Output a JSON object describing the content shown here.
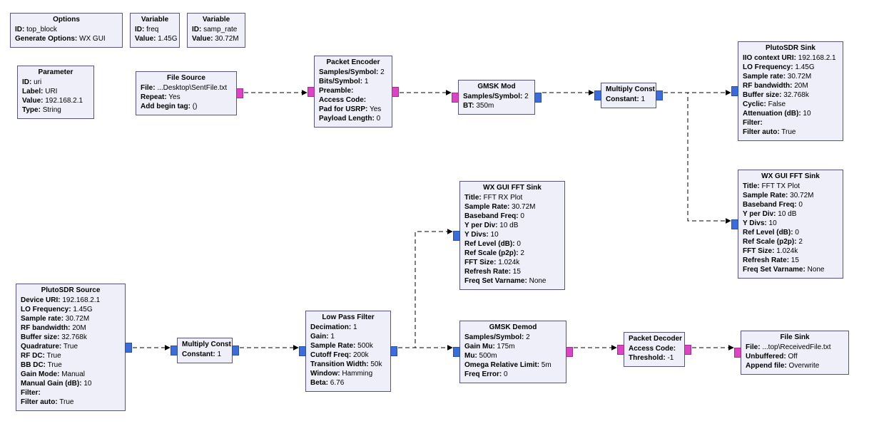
{
  "colors": {
    "block_bg": "#EFEFFA",
    "block_border": "#555577",
    "port_blue": "#3D6CD9",
    "port_magenta": "#D946C2",
    "arrow": "#000000"
  },
  "options": {
    "title": "Options",
    "rows": [
      {
        "k": "ID",
        "v": "top_block"
      },
      {
        "k": "Generate Options",
        "v": "WX GUI"
      }
    ]
  },
  "var_freq": {
    "title": "Variable",
    "rows": [
      {
        "k": "ID",
        "v": "freq"
      },
      {
        "k": "Value",
        "v": "1.45G"
      }
    ]
  },
  "var_samp": {
    "title": "Variable",
    "rows": [
      {
        "k": "ID",
        "v": "samp_rate"
      },
      {
        "k": "Value",
        "v": "30.72M"
      }
    ]
  },
  "parameter": {
    "title": "Parameter",
    "rows": [
      {
        "k": "ID",
        "v": "uri"
      },
      {
        "k": "Label",
        "v": "URI"
      },
      {
        "k": "Value",
        "v": "192.168.2.1"
      },
      {
        "k": "Type",
        "v": "String"
      }
    ]
  },
  "file_source": {
    "title": "File Source",
    "rows": [
      {
        "k": "File",
        "v": "...Desktop\\SentFile.txt"
      },
      {
        "k": "Repeat",
        "v": "Yes"
      },
      {
        "k": "Add begin tag",
        "v": "()"
      }
    ]
  },
  "packet_encoder": {
    "title": "Packet Encoder",
    "rows": [
      {
        "k": "Samples/Symbol",
        "v": "2"
      },
      {
        "k": "Bits/Symbol",
        "v": "1"
      },
      {
        "k": "Preamble",
        "v": ""
      },
      {
        "k": "Access Code",
        "v": ""
      },
      {
        "k": "Pad for USRP",
        "v": "Yes"
      },
      {
        "k": "Payload Length",
        "v": "0"
      }
    ]
  },
  "gmsk_mod": {
    "title": "GMSK Mod",
    "rows": [
      {
        "k": "Samples/Symbol",
        "v": "2"
      },
      {
        "k": "BT",
        "v": "350m"
      }
    ]
  },
  "mult_const_tx": {
    "title": "Multiply Const",
    "rows": [
      {
        "k": "Constant",
        "v": "1"
      }
    ]
  },
  "pluto_sink": {
    "title": "PlutoSDR Sink",
    "rows": [
      {
        "k": "IIO context URI",
        "v": "192.168.2.1"
      },
      {
        "k": "LO Frequency",
        "v": "1.45G"
      },
      {
        "k": "Sample rate",
        "v": "30.72M"
      },
      {
        "k": "RF bandwidth",
        "v": "20M"
      },
      {
        "k": "Buffer size",
        "v": "32.768k"
      },
      {
        "k": "Cyclic",
        "v": "False"
      },
      {
        "k": "Attenuation (dB)",
        "v": "10"
      },
      {
        "k": "Filter",
        "v": ""
      },
      {
        "k": "Filter auto",
        "v": "True"
      }
    ]
  },
  "fft_tx": {
    "title": "WX GUI FFT Sink",
    "rows": [
      {
        "k": "Title",
        "v": "FFT TX Plot"
      },
      {
        "k": "Sample Rate",
        "v": "30.72M"
      },
      {
        "k": "Baseband Freq",
        "v": "0"
      },
      {
        "k": "Y per Div",
        "v": "10 dB"
      },
      {
        "k": "Y Divs",
        "v": "10"
      },
      {
        "k": "Ref Level (dB)",
        "v": "0"
      },
      {
        "k": "Ref Scale (p2p)",
        "v": "2"
      },
      {
        "k": "FFT Size",
        "v": "1.024k"
      },
      {
        "k": "Refresh Rate",
        "v": "15"
      },
      {
        "k": "Freq Set Varname",
        "v": "None"
      }
    ]
  },
  "pluto_source": {
    "title": "PlutoSDR Source",
    "rows": [
      {
        "k": "Device URI",
        "v": "192.168.2.1"
      },
      {
        "k": "LO Frequency",
        "v": "1.45G"
      },
      {
        "k": "Sample rate",
        "v": "30.72M"
      },
      {
        "k": "RF bandwidth",
        "v": "20M"
      },
      {
        "k": "Buffer size",
        "v": "32.768k"
      },
      {
        "k": "Quadrature",
        "v": "True"
      },
      {
        "k": "RF DC",
        "v": "True"
      },
      {
        "k": "BB DC",
        "v": "True"
      },
      {
        "k": "Gain Mode",
        "v": "Manual"
      },
      {
        "k": "Manual Gain (dB)",
        "v": "10"
      },
      {
        "k": "Filter",
        "v": ""
      },
      {
        "k": "Filter auto",
        "v": "True"
      }
    ]
  },
  "mult_const_rx": {
    "title": "Multiply Const",
    "rows": [
      {
        "k": "Constant",
        "v": "1"
      }
    ]
  },
  "lpf": {
    "title": "Low Pass Filter",
    "rows": [
      {
        "k": "Decimation",
        "v": "1"
      },
      {
        "k": "Gain",
        "v": "1"
      },
      {
        "k": "Sample Rate",
        "v": "500k"
      },
      {
        "k": "Cutoff Freq",
        "v": "200k"
      },
      {
        "k": "Transition Width",
        "v": "50k"
      },
      {
        "k": "Window",
        "v": "Hamming"
      },
      {
        "k": "Beta",
        "v": "6.76"
      }
    ]
  },
  "fft_rx": {
    "title": "WX GUI FFT Sink",
    "rows": [
      {
        "k": "Title",
        "v": "FFT RX Plot"
      },
      {
        "k": "Sample Rate",
        "v": "30.72M"
      },
      {
        "k": "Baseband Freq",
        "v": "0"
      },
      {
        "k": "Y per Div",
        "v": "10 dB"
      },
      {
        "k": "Y Divs",
        "v": "10"
      },
      {
        "k": "Ref Level (dB)",
        "v": "0"
      },
      {
        "k": "Ref Scale (p2p)",
        "v": "2"
      },
      {
        "k": "FFT Size",
        "v": "1.024k"
      },
      {
        "k": "Refresh Rate",
        "v": "15"
      },
      {
        "k": "Freq Set Varname",
        "v": "None"
      }
    ]
  },
  "gmsk_demod": {
    "title": "GMSK Demod",
    "rows": [
      {
        "k": "Samples/Symbol",
        "v": "2"
      },
      {
        "k": "Gain Mu",
        "v": "175m"
      },
      {
        "k": "Mu",
        "v": "500m"
      },
      {
        "k": "Omega Relative Limit",
        "v": "5m"
      },
      {
        "k": "Freq Error",
        "v": "0"
      }
    ]
  },
  "packet_decoder": {
    "title": "Packet Decoder",
    "rows": [
      {
        "k": "Access Code",
        "v": ""
      },
      {
        "k": "Threshold",
        "v": "-1"
      }
    ]
  },
  "file_sink": {
    "title": "File Sink",
    "rows": [
      {
        "k": "File",
        "v": "...top\\ReceivedFile.txt"
      },
      {
        "k": "Unbuffered",
        "v": "Off"
      },
      {
        "k": "Append file",
        "v": "Overwrite"
      }
    ]
  }
}
